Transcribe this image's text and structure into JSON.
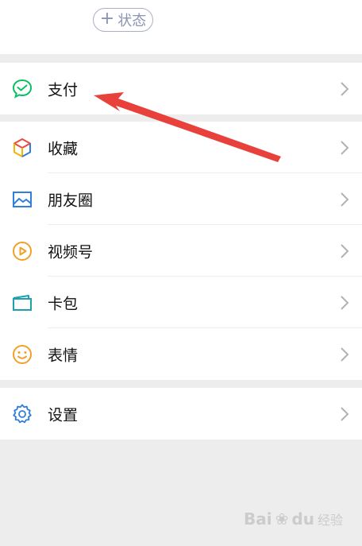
{
  "header": {
    "status_button": {
      "plus": "+",
      "label": "状态"
    }
  },
  "payment": {
    "label": "支付",
    "icon": "wechat-pay-icon",
    "icon_color": "#07c160"
  },
  "menu": [
    {
      "label": "收藏",
      "icon": "favorites-cube-icon"
    },
    {
      "label": "朋友圈",
      "icon": "moments-picture-icon",
      "icon_color": "#2f7fdc"
    },
    {
      "label": "视频号",
      "icon": "channels-play-icon",
      "icon_color": "#f0a12a"
    },
    {
      "label": "卡包",
      "icon": "card-wallet-icon",
      "icon_color": "#1ea0b0"
    },
    {
      "label": "表情",
      "icon": "sticker-smiley-icon",
      "icon_color": "#f0a12a"
    }
  ],
  "settings": {
    "label": "设置",
    "icon": "settings-gear-icon",
    "icon_color": "#2f7fdc"
  },
  "annotation": {
    "arrow_color": "#e8413c"
  },
  "watermark": {
    "brand": "Bai",
    "brand2": "du",
    "sub": "经验"
  }
}
